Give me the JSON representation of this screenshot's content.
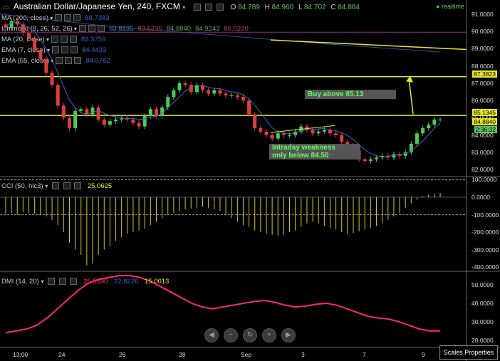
{
  "header": {
    "title": "Australian Dollar/Japanese Yen, 240, FXCM",
    "ohlc": {
      "o_label": "O",
      "o": "84.789",
      "h_label": "H",
      "h": "84.960",
      "l_label": "L",
      "l": "84.702",
      "c_label": "C",
      "c": "84.884"
    },
    "realtime": "realtime"
  },
  "indicators": [
    {
      "name": "MA (200, close)",
      "values": [
        "88.7383"
      ],
      "colors": [
        "#3a66c8"
      ]
    },
    {
      "name": "Ichimoku (9, 26, 52, 26)",
      "values": [
        "83.8235",
        "83.6235",
        "84.8840",
        "84.9243",
        "86.0220"
      ],
      "colors": [
        "#3a8fd8",
        "#d04040",
        "#5aa85a",
        "#5aa85a",
        "#c0407a"
      ]
    },
    {
      "name": "MA (20, close)",
      "values": [
        "83.3759"
      ],
      "colors": [
        "#3a66c8"
      ]
    },
    {
      "name": "EMA (7, close)",
      "values": [
        "84.4433"
      ],
      "colors": [
        "#3a66c8"
      ]
    },
    {
      "name": "EMA (55, close)",
      "values": [
        "84.6762"
      ],
      "colors": [
        "#3a66c8"
      ]
    }
  ],
  "cci_panel": {
    "name": "CCI (50, hlc3)",
    "value": "25.0625",
    "value_color": "#e8e820"
  },
  "dmi_panel": {
    "name": "DMI (14, 20)",
    "values": [
      "25.5590",
      "22.8226",
      "15.0013"
    ],
    "colors": [
      "#ff3366",
      "#3a66c8",
      "#e8e820"
    ]
  },
  "annotations": {
    "buy": "Buy above 85.13",
    "weak_line1": "Intraday weakness",
    "weak_line2": "only below 84.50"
  },
  "scales_button": "Scales Properties",
  "price_tags": {
    "resistance": "87.3823",
    "support": "85.1345",
    "last": "84.8840",
    "misc": "2:36:32"
  },
  "nav_icons": [
    "circle-left-icon",
    "zoom-out-icon",
    "reset-icon",
    "zoom-in-icon",
    "circle-right-icon"
  ],
  "chart_data": {
    "type": "candlestick",
    "instrument": "Australian Dollar/Japanese Yen, 240, FXCM",
    "price_axis_ticks": [
      91.0,
      90.0,
      89.0,
      88.0,
      87.0,
      86.0,
      85.0,
      84.0,
      83.0,
      82.0
    ],
    "time_axis_ticks": [
      "13:00",
      "24",
      "26",
      "28",
      "Sep",
      "3",
      "5",
      "7",
      "9"
    ],
    "horizontal_levels": [
      87.3823,
      85.1345
    ],
    "candles_close": [
      90.2,
      90.6,
      90.4,
      89.9,
      89.6,
      88.9,
      88.4,
      87.6,
      86.9,
      85.7,
      85.0,
      84.4,
      85.4,
      85.5,
      85.2,
      85.6,
      84.9,
      84.6,
      84.8,
      84.9,
      85.0,
      84.9,
      84.7,
      84.5,
      85.1,
      85.5,
      85.1,
      85.6,
      86.2,
      86.6,
      87.0,
      86.9,
      86.5,
      86.9,
      86.6,
      86.4,
      86.6,
      86.4,
      86.3,
      86.3,
      86.2,
      86.0,
      85.2,
      84.4,
      84.2,
      84.0,
      83.8,
      84.1,
      84.0,
      84.0,
      84.2,
      84.5,
      84.3,
      84.1,
      84.2,
      84.3,
      84.1,
      84.0,
      83.6,
      83.4,
      83.1,
      82.6,
      82.5,
      82.6,
      82.7,
      82.8,
      82.7,
      82.9,
      82.8,
      83.0,
      83.5,
      84.1,
      84.4,
      84.6,
      84.9,
      84.9
    ],
    "cci_axis_ticks": [
      100.0,
      0.0,
      -100.0,
      -200.0,
      -300.0,
      -400.0
    ],
    "cci_levels": [
      100,
      -100
    ],
    "cci_values": [
      -95,
      -90,
      -100,
      -85,
      -90,
      -95,
      -100,
      -110,
      -130,
      -160,
      -200,
      -260,
      -300,
      -330,
      -390,
      -380,
      -330,
      -300,
      -280,
      -250,
      -230,
      -210,
      -200,
      -190,
      -180,
      -160,
      -140,
      -120,
      -100,
      -90,
      -80,
      -70,
      -65,
      -60,
      -55,
      -60,
      -70,
      -80,
      -100,
      -120,
      -140,
      -160,
      -170,
      -190,
      -200,
      -210,
      -215,
      -220,
      -215,
      -200,
      -190,
      -170,
      -150,
      -140,
      -150,
      -165,
      -175,
      -185,
      -200,
      -210,
      -205,
      -195,
      -185,
      -175,
      -165,
      -150,
      -130,
      -110,
      -90,
      -60,
      -35,
      -15,
      5,
      15,
      20,
      25
    ],
    "dmi_axis_ticks": [
      50.0,
      40.0,
      30.0,
      20.0
    ],
    "dmi_series": {
      "name": "DMI",
      "values": [
        24,
        25,
        26,
        28,
        32,
        37,
        42,
        47,
        51,
        53,
        54,
        55,
        55,
        54,
        52,
        49,
        46,
        43,
        40,
        38,
        37,
        38,
        39,
        40,
        41,
        41.5,
        40.5,
        39,
        38,
        38.5,
        39.5,
        40,
        39,
        37,
        35,
        33,
        32,
        31.5,
        30,
        28,
        26,
        25,
        25
      ]
    }
  }
}
